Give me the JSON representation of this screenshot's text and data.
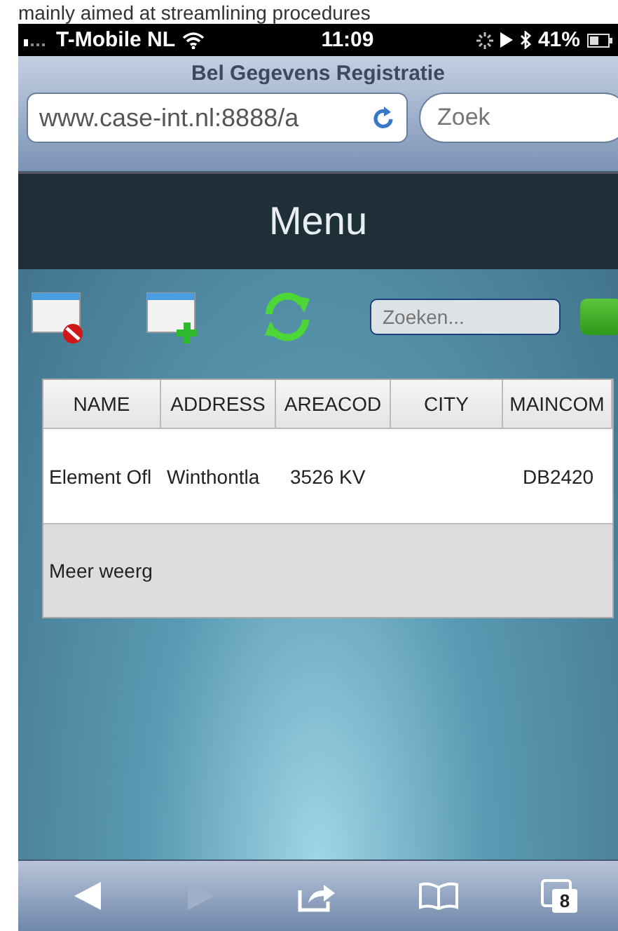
{
  "caption": "mainly aimed at streamlining procedures",
  "status_bar": {
    "carrier": "T-Mobile NL",
    "time": "11:09",
    "battery": "41%"
  },
  "browser": {
    "title": "Bel Gegevens Registratie",
    "url": "www.case-int.nl:8888/a",
    "search": {
      "placeholder": "Zoek"
    }
  },
  "header": {
    "title": "Menu"
  },
  "toolbar": {
    "search": {
      "placeholder": "Zoeken..."
    }
  },
  "table": {
    "columns": [
      "NAME",
      "ADDRESS",
      "AREACOD",
      "CITY",
      "MAINCOM"
    ],
    "rows": [
      {
        "name": "Element Ofl",
        "address": "Winthontla",
        "areacod": "3526 KV",
        "maincom": "DB2420"
      }
    ],
    "more": "Meer weerg"
  },
  "bottom_bar": {
    "back_disabled": false,
    "forward_disabled": true,
    "tab_count": "8"
  }
}
